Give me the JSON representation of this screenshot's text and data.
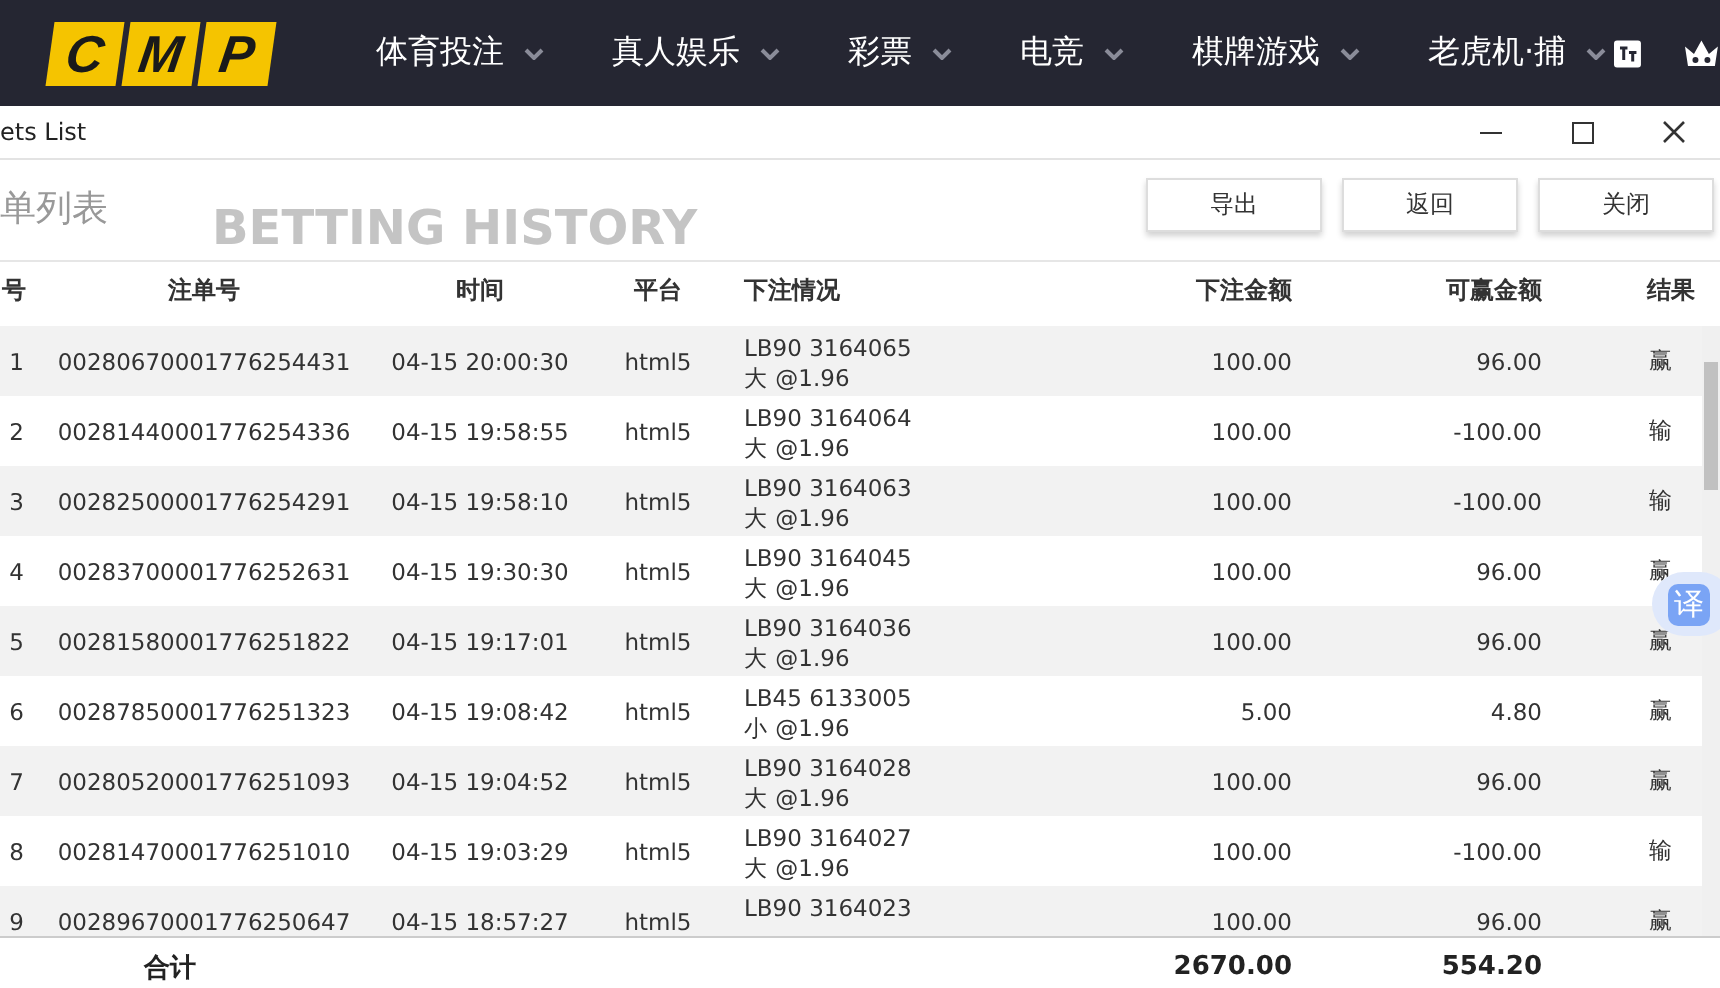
{
  "nav": {
    "logo": [
      "C",
      "M",
      "P"
    ],
    "items": [
      {
        "label": "体育投注"
      },
      {
        "label": "真人娱乐"
      },
      {
        "label": "彩票"
      },
      {
        "label": "电竞"
      },
      {
        "label": "棋牌游戏"
      },
      {
        "label": "老虎机·捕"
      }
    ]
  },
  "window": {
    "title": "ets List"
  },
  "header": {
    "title": "单列表",
    "subtitle": "BETTING HISTORY",
    "buttons": [
      "导出",
      "返回",
      "关闭"
    ]
  },
  "table": {
    "columns": [
      "号",
      "注单号",
      "时间",
      "平台",
      "下注情况",
      "下注金额",
      "可赢金额",
      "结果"
    ],
    "rows": [
      {
        "no": "1",
        "bet_id": "00280670001776254431",
        "time": "04-15 20:00:30",
        "platform": "html5",
        "detail": [
          "LB90 3164065",
          "大 @1.96"
        ],
        "stake": "100.00",
        "win": "96.00",
        "result": "赢"
      },
      {
        "no": "2",
        "bet_id": "00281440001776254336",
        "time": "04-15 19:58:55",
        "platform": "html5",
        "detail": [
          "LB90 3164064",
          "大 @1.96"
        ],
        "stake": "100.00",
        "win": "-100.00",
        "result": "输"
      },
      {
        "no": "3",
        "bet_id": "00282500001776254291",
        "time": "04-15 19:58:10",
        "platform": "html5",
        "detail": [
          "LB90 3164063",
          "大 @1.96"
        ],
        "stake": "100.00",
        "win": "-100.00",
        "result": "输"
      },
      {
        "no": "4",
        "bet_id": "00283700001776252631",
        "time": "04-15 19:30:30",
        "platform": "html5",
        "detail": [
          "LB90 3164045",
          "大 @1.96"
        ],
        "stake": "100.00",
        "win": "96.00",
        "result": "赢"
      },
      {
        "no": "5",
        "bet_id": "00281580001776251822",
        "time": "04-15 19:17:01",
        "platform": "html5",
        "detail": [
          "LB90 3164036",
          "大 @1.96"
        ],
        "stake": "100.00",
        "win": "96.00",
        "result": "赢"
      },
      {
        "no": "6",
        "bet_id": "00287850001776251323",
        "time": "04-15 19:08:42",
        "platform": "html5",
        "detail": [
          "LB45 6133005",
          "小 @1.96"
        ],
        "stake": "5.00",
        "win": "4.80",
        "result": "赢"
      },
      {
        "no": "7",
        "bet_id": "00280520001776251093",
        "time": "04-15 19:04:52",
        "platform": "html5",
        "detail": [
          "LB90 3164028",
          "大 @1.96"
        ],
        "stake": "100.00",
        "win": "96.00",
        "result": "赢"
      },
      {
        "no": "8",
        "bet_id": "00281470001776251010",
        "time": "04-15 19:03:29",
        "platform": "html5",
        "detail": [
          "LB90 3164027",
          "大 @1.96"
        ],
        "stake": "100.00",
        "win": "-100.00",
        "result": "输"
      },
      {
        "no": "9",
        "bet_id": "00289670001776250647",
        "time": "04-15 18:57:27",
        "platform": "html5",
        "detail": [
          "LB90 3164023"
        ],
        "stake": "100.00",
        "win": "96.00",
        "result": "赢"
      }
    ],
    "footer": {
      "label": "合计",
      "stake": "2670.00",
      "win": "554.20"
    }
  },
  "translate_button": {
    "label": "译"
  }
}
